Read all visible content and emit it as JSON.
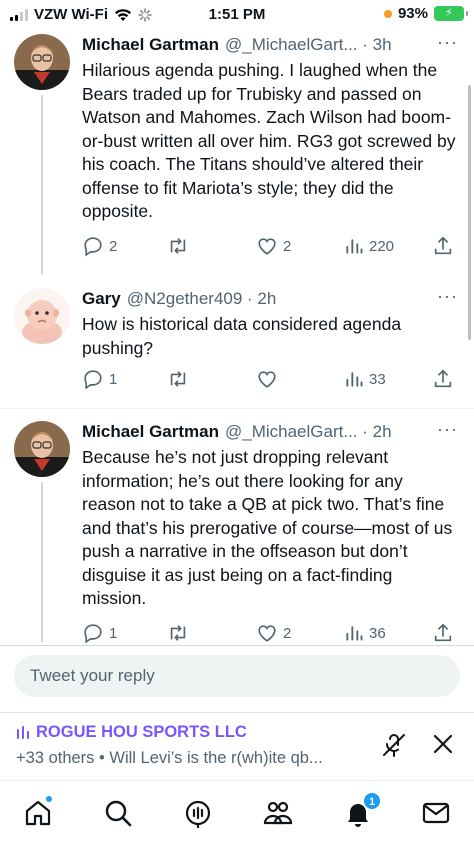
{
  "status_bar": {
    "carrier": "VZW Wi-Fi",
    "time": "1:51 PM",
    "battery_percent": "93%"
  },
  "tweets": [
    {
      "name": "Michael Gartman",
      "handle": "@_MichaelGart... · 3h",
      "text": "Hilarious agenda pushing. I laughed when the Bears traded up for Trubisky and passed on Watson and Mahomes. Zach Wilson had boom-or-bust written all over him. RG3 got screwed by his coach. The Titans should’ve altered their offense to fit Mariota’s style; they did the opposite.",
      "replies": "2",
      "retweets": "",
      "likes": "2",
      "views": "220"
    },
    {
      "name": "Gary",
      "handle": "@N2gether409 · 2h",
      "text": "How is historical data considered agenda pushing?",
      "replies": "1",
      "retweets": "",
      "likes": "",
      "views": "33"
    },
    {
      "name": "Michael Gartman",
      "handle": "@_MichaelGart... · 2h",
      "text": "Because he’s not just dropping relevant information; he’s out there looking for any reason not to take a QB at pick two. That’s fine and that’s his prerogative of course—most of us push a narrative in the offseason but don’t disguise it as just being on a fact-finding mission.",
      "replies": "1",
      "retweets": "",
      "likes": "2",
      "views": "36"
    }
  ],
  "reply_box": {
    "placeholder": "Tweet your reply"
  },
  "spaces_bar": {
    "host": "ROGUE HOU SPORTS LLC",
    "subtitle": "+33 others • Will Levi’s is the r(wh)ite qb..."
  },
  "nav": {
    "notifications_count": "1",
    "items": [
      "home-icon",
      "search-icon",
      "spaces-icon",
      "communities-icon",
      "notifications-icon",
      "messages-icon"
    ]
  },
  "colors": {
    "accent": "#1d9bf0",
    "spaces": "#7856ff",
    "muted": "#536471"
  }
}
